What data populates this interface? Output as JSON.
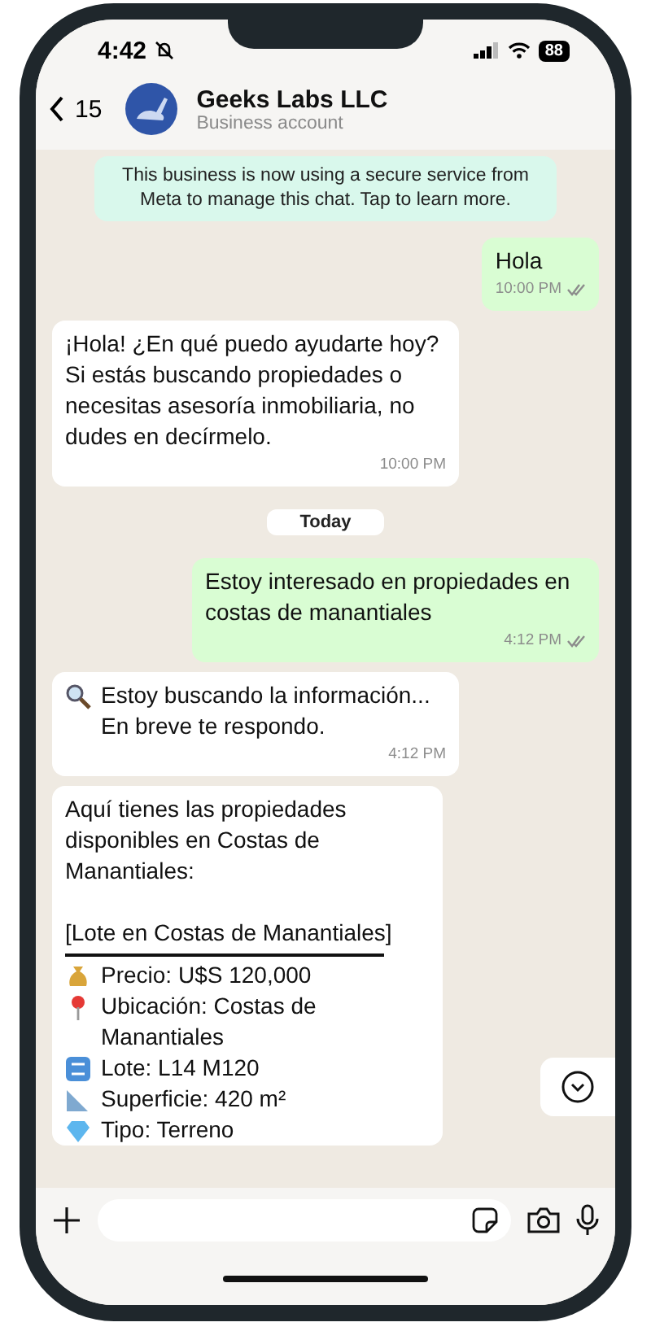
{
  "status_bar": {
    "time": "4:42",
    "battery": "88"
  },
  "header": {
    "back_count": "15",
    "name": "Geeks Labs LLC",
    "subtitle": "Business account"
  },
  "messages": [
    {
      "kind": "system",
      "text": "This business is now using a secure service from Meta to manage this chat. Tap to learn more."
    },
    {
      "kind": "out",
      "text": "Hola",
      "time": "10:00 PM"
    },
    {
      "kind": "in",
      "text": "¡Hola! ¿En qué puedo ayudarte hoy? Si estás buscando propiedades o necesitas asesoría inmobiliaria, no dudes en decírmelo.",
      "time": "10:00 PM"
    },
    {
      "kind": "date",
      "text": "Today"
    },
    {
      "kind": "out",
      "text": "Estoy interesado en propiedades en costas de manantiales",
      "time": "4:12 PM"
    },
    {
      "kind": "search",
      "text": "Estoy buscando la información... En breve te respondo.",
      "time": "4:12 PM"
    },
    {
      "kind": "listing",
      "intro": "Aquí tienes las propiedades disponibles en Costas de Manantiales:",
      "title": "[Lote en Costas de Manantiales]",
      "details": [
        {
          "kind": "price",
          "text": "Precio: U$S 120,000"
        },
        {
          "kind": "location",
          "text": "Ubicación: Costas de Manantiales"
        },
        {
          "kind": "lot",
          "text": "Lote: L14 M120"
        },
        {
          "kind": "area",
          "text": "Superficie: 420 m²"
        },
        {
          "kind": "type",
          "text": "Tipo: Terreno"
        }
      ]
    }
  ]
}
